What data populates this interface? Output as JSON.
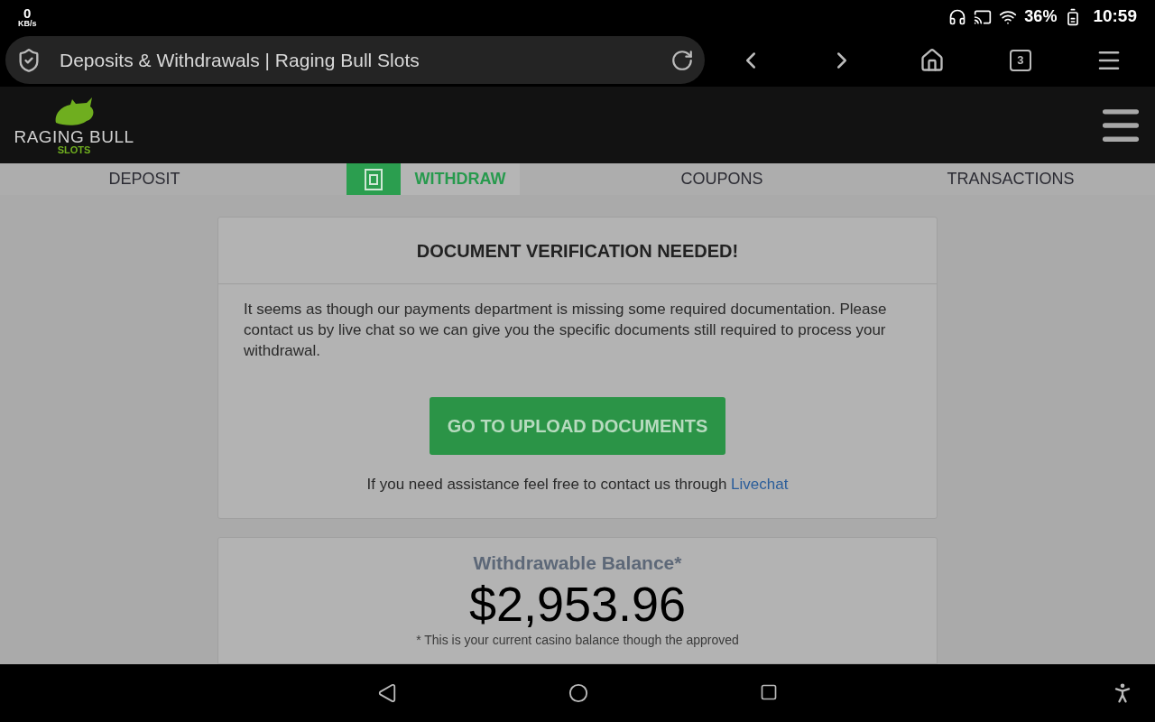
{
  "status_bar": {
    "speed_value": "0",
    "speed_unit": "KB/s",
    "battery": "36%",
    "time": "10:59"
  },
  "browser": {
    "page_title": "Deposits & Withdrawals | Raging Bull Slots",
    "tab_count": "3"
  },
  "site_header": {
    "logo_title": "RAGING BULL",
    "logo_subtitle": "SLOTS"
  },
  "tabs": [
    {
      "label": "DEPOSIT",
      "selected": false
    },
    {
      "label": "WITHDRAW",
      "selected": true
    },
    {
      "label": "COUPONS",
      "selected": false
    },
    {
      "label": "TRANSACTIONS",
      "selected": false
    }
  ],
  "verification_card": {
    "title": "DOCUMENT VERIFICATION NEEDED!",
    "message": "It seems as though our payments department is missing some required documentation. Please contact us by live chat so we can give you the specific documents still required to process your withdrawal.",
    "button": "GO TO UPLOAD DOCUMENTS",
    "help_text": "If you need assistance feel free to contact us through",
    "help_link": "Livechat"
  },
  "balance_card": {
    "label": "Withdrawable Balance*",
    "amount": "$2,953.96",
    "note": "* This is your current casino balance though the approved"
  }
}
